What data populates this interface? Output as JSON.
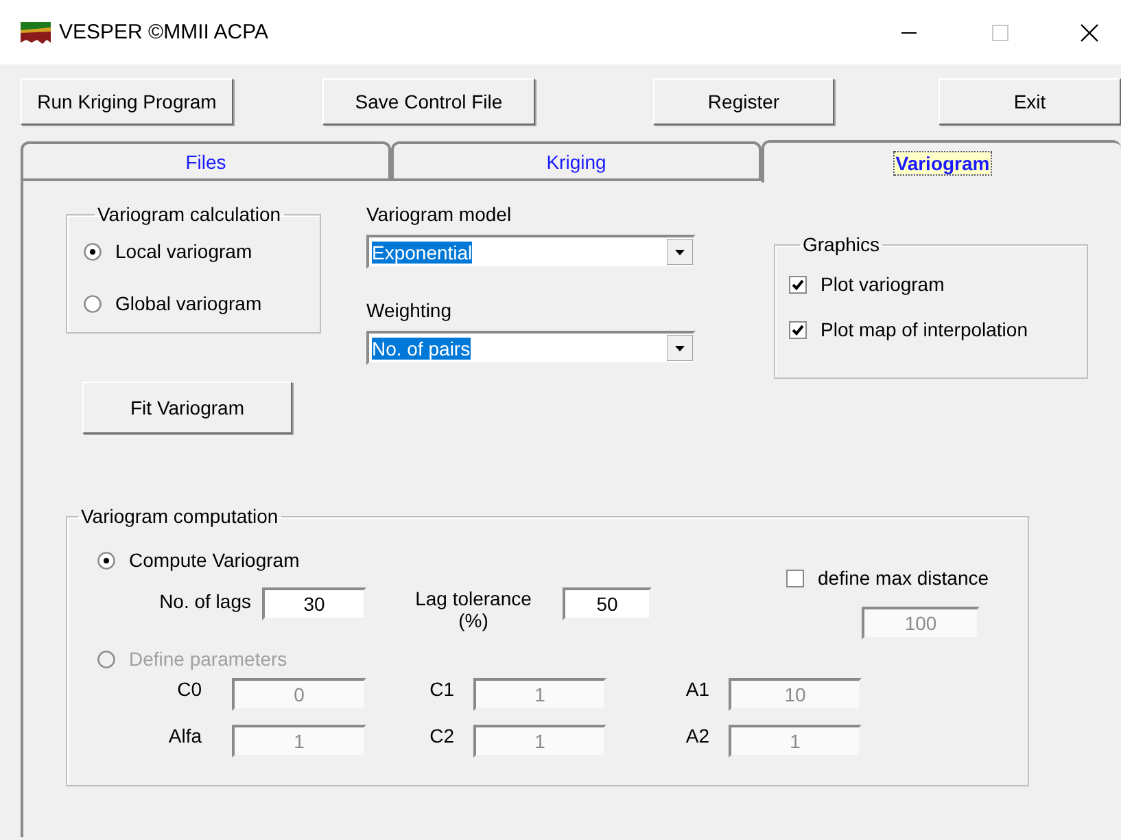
{
  "window": {
    "title": "VESPER ©MMII ACPA"
  },
  "toolbar_buttons": [
    "Run Kriging Program",
    "Save Control File",
    "Register",
    "Exit"
  ],
  "tabs": [
    {
      "label": "Files",
      "selected": false
    },
    {
      "label": "Kriging",
      "selected": false
    },
    {
      "label": "Variogram",
      "selected": true
    }
  ],
  "variogram_calculation": {
    "title": "Variogram calculation",
    "options": [
      {
        "label": "Local variogram",
        "selected": true
      },
      {
        "label": "Global variogram",
        "selected": false
      }
    ]
  },
  "variogram_model": {
    "label": "Variogram model",
    "value": "Exponential"
  },
  "weighting": {
    "label": "Weighting",
    "value": "No. of pairs"
  },
  "graphics": {
    "title": "Graphics",
    "options": [
      {
        "label": "Plot variogram",
        "checked": true
      },
      {
        "label": "Plot map of interpolation",
        "checked": true
      }
    ]
  },
  "fit_button": "Fit Variogram",
  "variogram_computation": {
    "title": "Variogram computation",
    "modes": [
      {
        "label": "Compute Variogram",
        "selected": true,
        "disabled": false
      },
      {
        "label": "Define parameters",
        "selected": false,
        "disabled": true
      }
    ],
    "lags": {
      "label": "No. of lags",
      "value": "30"
    },
    "lag_tolerance": {
      "label": "Lag tolerance (%)",
      "value": "50"
    },
    "max_distance": {
      "label": "define max distance",
      "checked": false,
      "value": "100",
      "disabled": true
    },
    "parameters_disabled": true,
    "parameters": [
      {
        "label": "C0",
        "value": "0"
      },
      {
        "label": "C1",
        "value": "1"
      },
      {
        "label": "A1",
        "value": "10"
      },
      {
        "label": "Alfa",
        "value": "1"
      },
      {
        "label": "C2",
        "value": "1"
      },
      {
        "label": "A2",
        "value": "1"
      }
    ]
  }
}
